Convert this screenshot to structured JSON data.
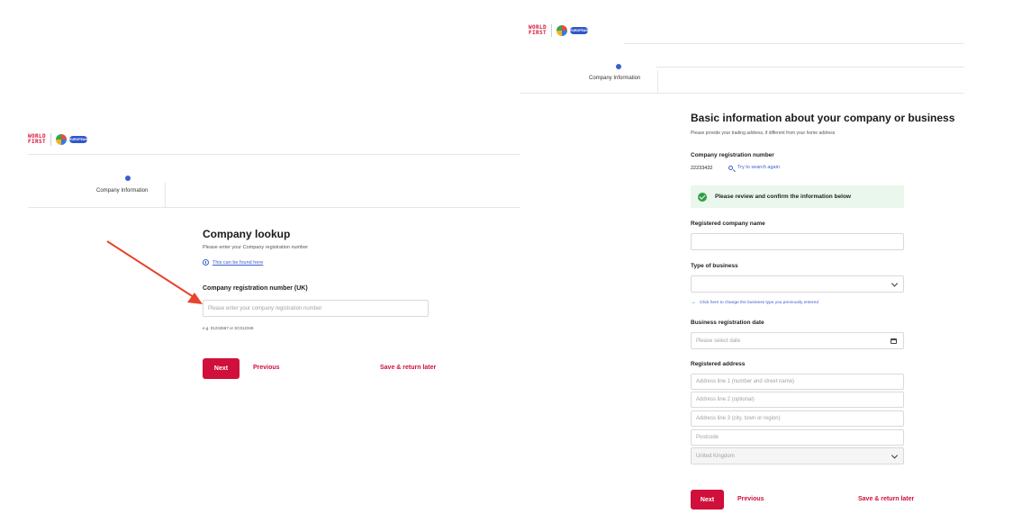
{
  "left": {
    "logo": {
      "line1": "WORLD",
      "line2": "FIRST",
      "badge": "EUROPEAN"
    },
    "step": {
      "label": "Company Information"
    },
    "title": "Company lookup",
    "subtitle": "Please enter your Company registration number",
    "hint_link": "This can be found here",
    "field_label": "Company registration number (UK)",
    "field_placeholder": "Please enter your company registration number",
    "example": "e.g. 01234567 or SC012345",
    "next": "Next",
    "previous": "Previous",
    "save": "Save & return later"
  },
  "right": {
    "logo": {
      "line1": "WORLD",
      "line2": "FIRST",
      "badge": "EUROPEAN"
    },
    "step": {
      "label": "Company Information"
    },
    "title": "Basic information about your company or business",
    "subtitle": "Please provide your trading address, if different from your home address",
    "reg_label": "Company registration number",
    "reg_value": "22233432",
    "search_again": "Try to search again",
    "success_msg": "Please review and confirm the information below",
    "company_name_label": "Registered company name",
    "company_name_value": "",
    "business_type_label": "Type of business",
    "business_type_value": "",
    "change_type_link": "Click here to change the business type you previously entered",
    "reg_date_label": "Business registration date",
    "reg_date_placeholder": "Please select date",
    "address_label": "Registered address",
    "address_line1_placeholder": "Address line 1 (number and street name)",
    "address_line2_placeholder": "Address line 2 (optional)",
    "address_line3_placeholder": "Address line 3 (city, town or region)",
    "postcode_placeholder": "Postcode",
    "country_value": "United Kingdom",
    "next": "Next",
    "previous": "Previous",
    "save": "Save & return later"
  },
  "icons": {
    "info": "info-icon",
    "search": "search-icon",
    "arrow": "arrow-right-icon",
    "calendar": "calendar-icon",
    "check": "check-circle-icon",
    "chevron": "chevron-down-icon"
  },
  "colors": {
    "brand_red": "#d0103a",
    "step_blue": "#3a5fcd",
    "success_green": "#2f9e46",
    "success_bg": "#eaf7ec",
    "annotation_arrow": "#e8432f"
  }
}
